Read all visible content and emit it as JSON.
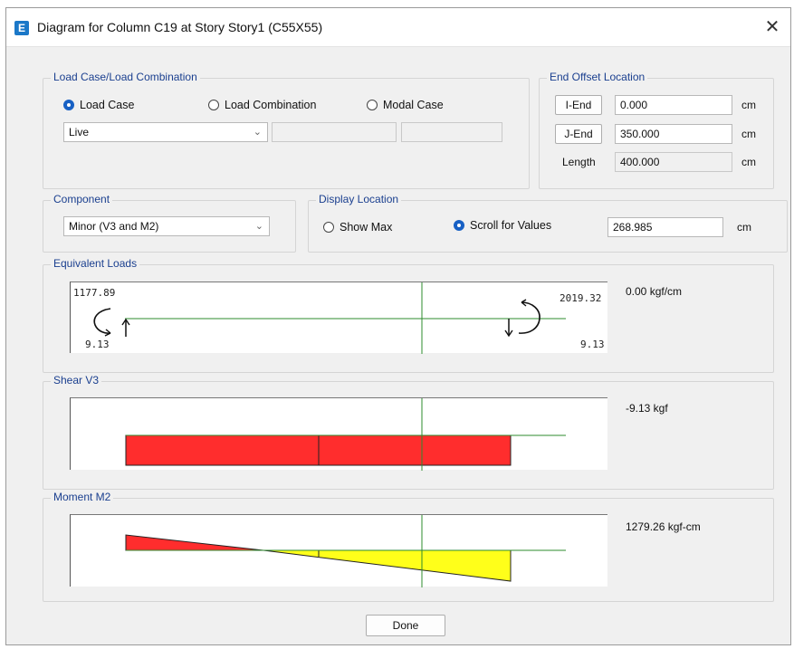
{
  "window": {
    "title": "Diagram for Column C19 at Story Story1 (C55X55)",
    "icon_letter": "E",
    "close_glyph": "✕"
  },
  "load_case_group": {
    "label": "Load Case/Load Combination",
    "options": [
      "Load Case",
      "Load Combination",
      "Modal Case"
    ],
    "selected": "Load Case",
    "case_value": "Live",
    "extra_field_1": "",
    "extra_field_2": ""
  },
  "end_offset": {
    "label": "End Offset Location",
    "i_end_label": "I-End",
    "i_end_value": "0.000",
    "j_end_label": "J-End",
    "j_end_value": "350.000",
    "length_label": "Length",
    "length_value": "400.000",
    "unit": "cm"
  },
  "component": {
    "label": "Component",
    "value": "Minor (V3 and M2)"
  },
  "display_location": {
    "label": "Display Location",
    "show_max_label": "Show Max",
    "scroll_label": "Scroll for Values",
    "selected": "Scroll for Values",
    "scroll_value": "268.985",
    "unit": "cm"
  },
  "equivalent_loads": {
    "label": "Equivalent Loads",
    "left_moment": "1177.89",
    "right_moment": "2019.32",
    "left_force": "9.13",
    "right_force": "9.13",
    "readout": "0.00 kgf/cm"
  },
  "shear": {
    "label": "Shear V3",
    "readout": "-9.13 kgf"
  },
  "moment": {
    "label": "Moment M2",
    "readout": "1279.26 kgf-cm"
  },
  "colors": {
    "negative": "#ff2d2d",
    "positive": "#ffff1a",
    "axis": "#2e8b2e",
    "accent": "#1760c4"
  },
  "done_label": "Done"
}
